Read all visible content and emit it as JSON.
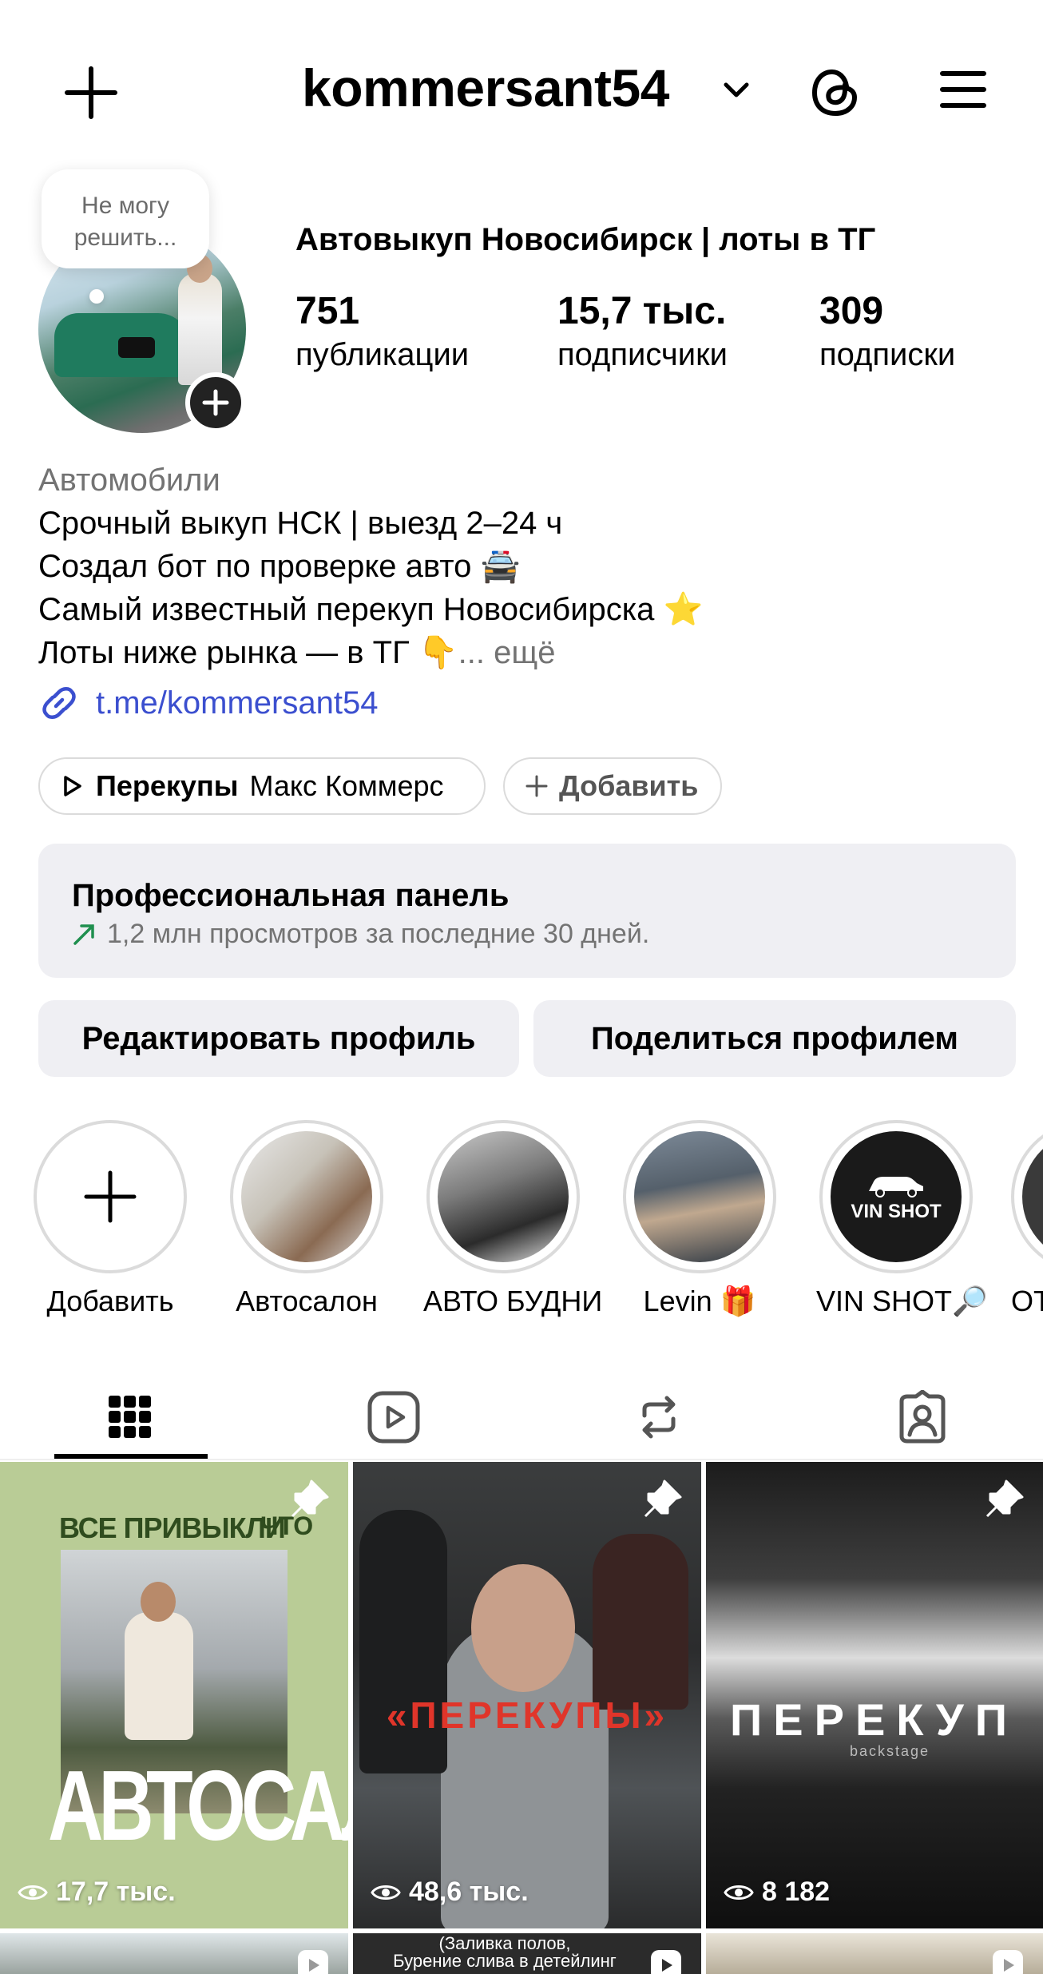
{
  "header": {
    "username": "kommersant54",
    "icons": [
      "plus-icon",
      "chevron-down-icon",
      "threads-icon",
      "menu-icon"
    ]
  },
  "profile": {
    "note": "Не могу решить...",
    "full_name": "Автовыкуп Новосибирск | лоты в ТГ",
    "stats": [
      {
        "value": "751",
        "label": "публикации"
      },
      {
        "value": "15,7 тыс.",
        "label": "подписчики"
      },
      {
        "value": "309",
        "label": "подписки"
      }
    ],
    "category": "Автомобили",
    "bio_lines": [
      "Срочный выкуп НСК | выезд 2–24 ч",
      "Создал бот по проверке авто 🚔",
      "Самый известный перекуп Новосибирска ⭐",
      "Лоты ниже рынка — в ТГ 👇"
    ],
    "bio_more": "... ещё",
    "link": "t.me/kommersant54"
  },
  "chips": {
    "music_bold": "Перекупы",
    "music_artist": "Макс Коммерс",
    "add_label": "Добавить"
  },
  "pro_panel": {
    "title": "Профессиональная панель",
    "subtitle": "1,2 млн просмотров за последние 30 дней."
  },
  "buttons": {
    "edit": "Редактировать профиль",
    "share": "Поделиться профилем"
  },
  "highlights": [
    {
      "label": "Добавить"
    },
    {
      "label": "Автосалон"
    },
    {
      "label": "АВТО БУДНИ"
    },
    {
      "label": "Levin 🎁"
    },
    {
      "label": "VIN SHOT🔎",
      "cover_text": "VIN SHOT"
    },
    {
      "label": "ОТ"
    }
  ],
  "tabs": [
    "grid-icon",
    "reels-icon",
    "reposts-icon",
    "tagged-icon"
  ],
  "posts": [
    {
      "views": "17,7 тыс.",
      "top_text": "ВСЕ ПРИВЫКЛИ",
      "top_text2": "ЧТО",
      "big_text": "АВТОСАЛОН"
    },
    {
      "views": "48,6 тыс.",
      "big_text": "«ПЕРЕКУПЫ»"
    },
    {
      "views": "8 182",
      "big_text": "ПЕРЕКУП",
      "small_text": "backstage"
    }
  ],
  "row2": {
    "caption": "(Заливка полов,\nБурение слива в детейлинг"
  }
}
